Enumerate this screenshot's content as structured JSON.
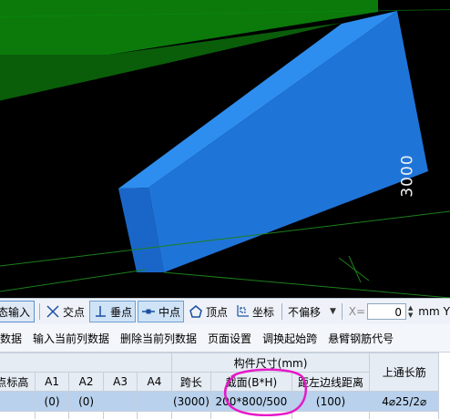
{
  "viewport": {
    "dimension_label": "3000",
    "colors": {
      "background": "#000000",
      "slab": "#0c7a0c",
      "beam_front": "#1f6fd0",
      "beam_top": "#2f8ff0",
      "grid_line": "#1f8a1f"
    }
  },
  "snapbar": {
    "dynamic_input": "态输入",
    "intersection": "交点",
    "perpendicular": "垂点",
    "midpoint": "中点",
    "vertex": "顶点",
    "coordinate": "坐标",
    "offset_mode": "不偏移",
    "x_label": "X=",
    "x_value": "0",
    "unit": "mm",
    "trailing": "Y"
  },
  "toolbar2": {
    "items": [
      "数据",
      "输入当前列数据",
      "删除当前列数据",
      "页面设置",
      "调换起始跨",
      "悬臂钢筋代号"
    ]
  },
  "table": {
    "group_header": "构件尺寸(mm)",
    "right_header": "上通长筋",
    "columns": [
      "点标高",
      "A1",
      "A2",
      "A3",
      "A4",
      "跨长",
      "截面(B*H)",
      "距左边线距离"
    ],
    "row": [
      "",
      "(0)",
      "(0)",
      "",
      "",
      "(3000)",
      "200*800/500",
      "(100)",
      "4⌀25/2⌀"
    ]
  },
  "annotation": {
    "color": "#e619c8"
  }
}
